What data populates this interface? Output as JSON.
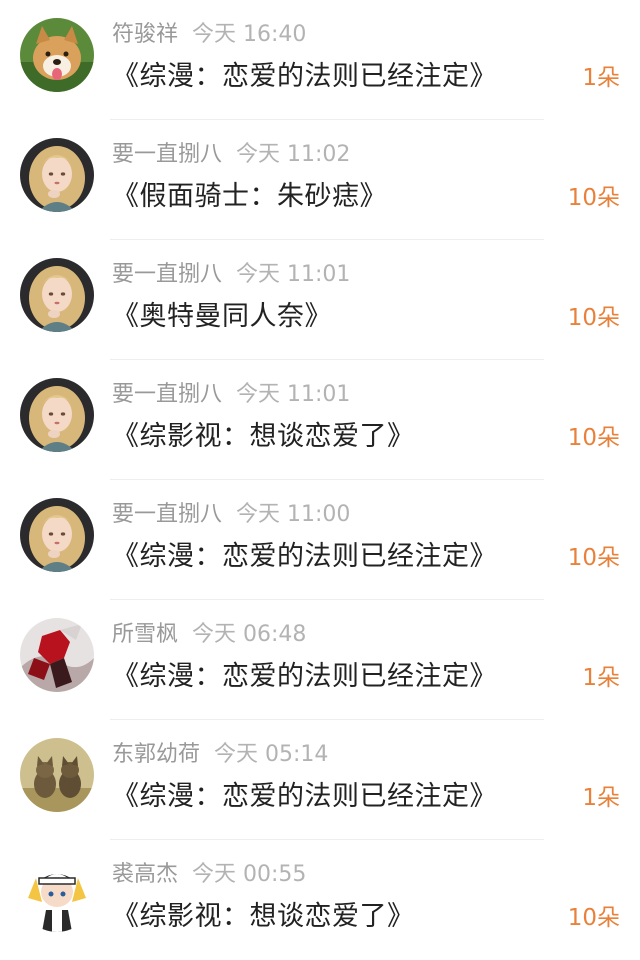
{
  "gifts": [
    {
      "avatar": "avatar-shiba-dog",
      "username": "符骏祥",
      "time": "今天 16:40",
      "title": "《综漫：恋爱的法则已经注定》",
      "count": "1朵"
    },
    {
      "avatar": "avatar-anime-girl-blonde",
      "username": "要一直捌八",
      "time": "今天 11:02",
      "title": "《假面骑士：朱砂痣》",
      "count": "10朵"
    },
    {
      "avatar": "avatar-anime-girl-blonde",
      "username": "要一直捌八",
      "time": "今天 11:01",
      "title": "《奥特曼同人奈》",
      "count": "10朵"
    },
    {
      "avatar": "avatar-anime-girl-blonde",
      "username": "要一直捌八",
      "time": "今天 11:01",
      "title": "《综影视：想谈恋爱了》",
      "count": "10朵"
    },
    {
      "avatar": "avatar-anime-girl-blonde",
      "username": "要一直捌八",
      "time": "今天 11:00",
      "title": "《综漫：恋爱的法则已经注定》",
      "count": "10朵"
    },
    {
      "avatar": "avatar-red-armored-character",
      "username": "所雪枫",
      "time": "今天 06:48",
      "title": "《综漫：恋爱的法则已经注定》",
      "count": "1朵"
    },
    {
      "avatar": "avatar-two-cats",
      "username": "东郭幼荷",
      "time": "今天 05:14",
      "title": "《综漫：恋爱的法则已经注定》",
      "count": "1朵"
    },
    {
      "avatar": "avatar-chibi-cap-character",
      "username": "裘高杰",
      "time": "今天 00:55",
      "title": "《综影视：想谈恋爱了》",
      "count": "10朵"
    }
  ]
}
